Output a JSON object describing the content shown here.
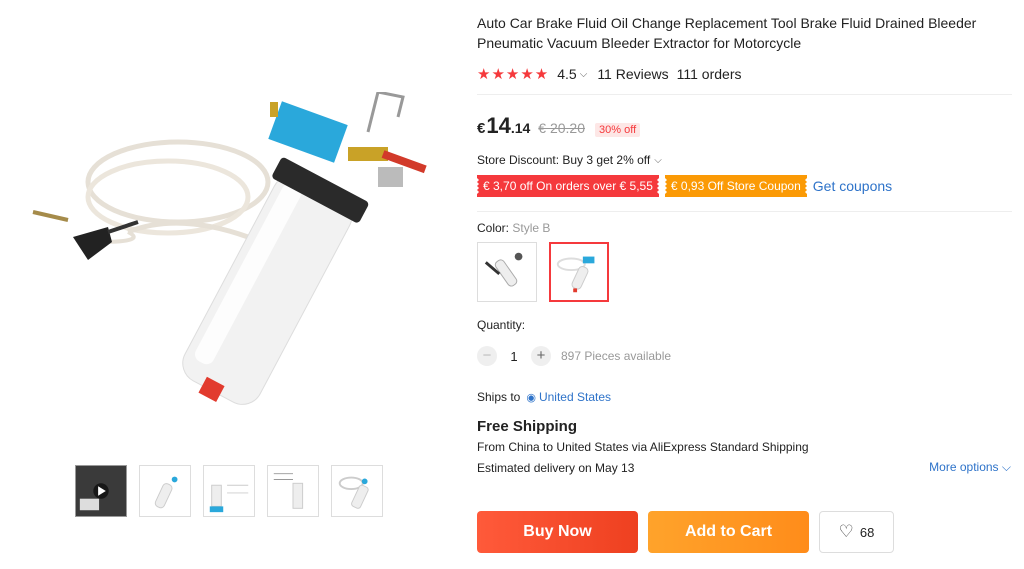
{
  "product": {
    "title": "Auto Car Brake Fluid Oil Change Replacement Tool Brake Fluid Drained Bleeder Pneumatic Vacuum Bleeder Extractor for Motorcycle",
    "rating": "4.5",
    "stars": "★★★★★",
    "reviews": "11 Reviews",
    "orders": "111 orders"
  },
  "price": {
    "currency": "€",
    "integer": "14",
    "decimal": ".14",
    "original": "€ 20.20",
    "discount": "30% off"
  },
  "store_discount": "Store Discount: Buy 3 get 2% off",
  "coupons": {
    "red": "€ 3,70 off On orders over € 5,55",
    "orange": "€ 0,93 Off Store Coupon",
    "get_label": "Get coupons"
  },
  "color": {
    "label": "Color:",
    "value": "Style B"
  },
  "quantity": {
    "label": "Quantity:",
    "minus": "−",
    "value": "1",
    "plus": "+",
    "available": "897 Pieces available"
  },
  "shipping": {
    "ships_to_label": "Ships to",
    "country": "United States",
    "free": "Free Shipping",
    "from_label": "From",
    "from_country": "China",
    "to_label": "to",
    "to_country": "United States",
    "via": "via AliExpress Standard Shipping",
    "estimated": "Estimated delivery on May 13",
    "more_options": "More options"
  },
  "actions": {
    "buy_now": "Buy Now",
    "add_to_cart": "Add to Cart",
    "wishlist_count": "68"
  },
  "icons": {
    "star": "star-icon",
    "chevron": "chevron-down-icon",
    "pin": "location-pin-icon",
    "heart": "heart-icon"
  },
  "colors": {
    "accent_red": "#f5393c",
    "coupon_orange": "#fb9a05",
    "link_blue": "#2e73c9",
    "buy_now": "#ee4020",
    "add_to_cart": "#ff8c1a"
  }
}
